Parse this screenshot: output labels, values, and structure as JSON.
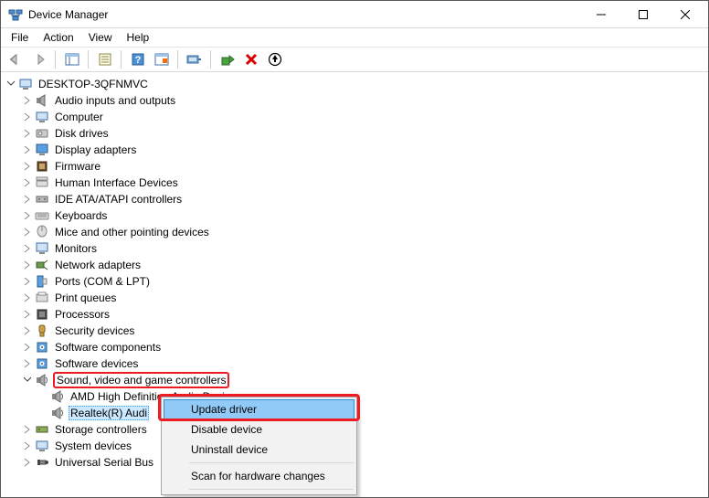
{
  "window": {
    "title": "Device Manager"
  },
  "menubar": {
    "file": "File",
    "action": "Action",
    "view": "View",
    "help": "Help"
  },
  "root": "DESKTOP-3QFNMVC",
  "categories": [
    "Audio inputs and outputs",
    "Computer",
    "Disk drives",
    "Display adapters",
    "Firmware",
    "Human Interface Devices",
    "IDE ATA/ATAPI controllers",
    "Keyboards",
    "Mice and other pointing devices",
    "Monitors",
    "Network adapters",
    "Ports (COM & LPT)",
    "Print queues",
    "Processors",
    "Security devices",
    "Software components",
    "Software devices",
    "Sound, video and game controllers",
    "Storage controllers",
    "System devices",
    "Universal Serial Bus"
  ],
  "sound_children": [
    "AMD High Definition Audio Device",
    "Realtek(R) Audi"
  ],
  "context_menu": {
    "update": "Update driver",
    "disable": "Disable device",
    "uninstall": "Uninstall device",
    "scan": "Scan for hardware changes"
  }
}
